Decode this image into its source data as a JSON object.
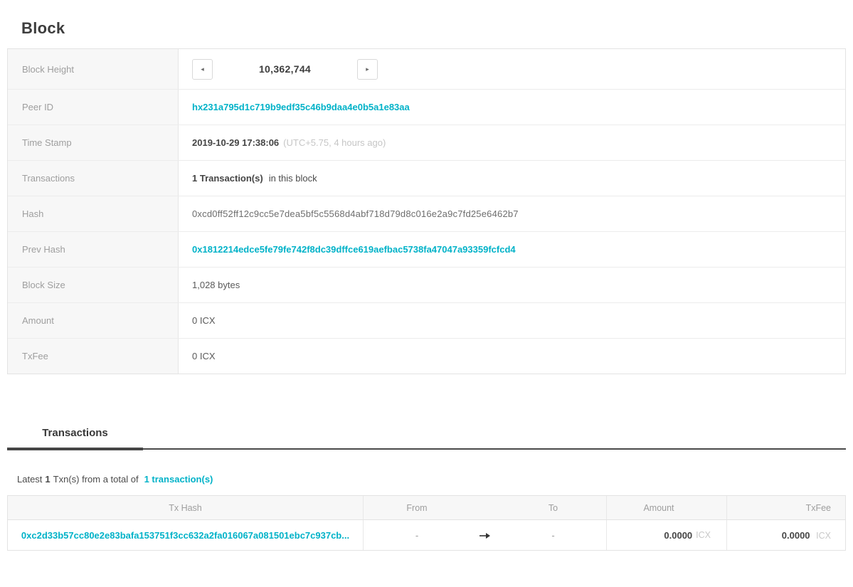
{
  "page": {
    "title": "Block"
  },
  "colors": {
    "accent": "#00b2c8",
    "label_gray": "#9e9e9e",
    "text_dark": "#454545",
    "text_light": "#c6c6c6",
    "border": "#e3e3e3",
    "label_bg": "#f7f7f7",
    "tab_line": "#464646"
  },
  "icons": {
    "prev_block": "◂",
    "next_block": "▸",
    "from_to_arrow": "arrow-right"
  },
  "block_detail": {
    "block_height": {
      "label": "Block Height",
      "value": "10,362,744"
    },
    "peer_id": {
      "label": "Peer ID",
      "value": "hx231a795d1c719b9edf35c46b9daa4e0b5a1e83aa"
    },
    "time_stamp": {
      "label": "Time Stamp",
      "value": "2019-10-29 17:38:06",
      "note": "(UTC+5.75, 4 hours ago)"
    },
    "transactions": {
      "label": "Transactions",
      "count": "1 Transaction(s)",
      "suffix": "in this block"
    },
    "hash": {
      "label": "Hash",
      "value": "0xcd0ff52ff12c9cc5e7dea5bf5c5568d4abf718d79d8c016e2a9c7fd25e6462b7"
    },
    "prev_hash": {
      "label": "Prev Hash",
      "value": "0x1812214edce5fe79fe742f8dc39dffce619aefbac5738fa47047a93359fcfcd4"
    },
    "block_size": {
      "label": "Block Size",
      "value": "1,028 bytes"
    },
    "amount": {
      "label": "Amount",
      "value": "0 ICX"
    },
    "txfee": {
      "label": "TxFee",
      "value": "0 ICX"
    }
  },
  "transactions_section": {
    "tab_label": "Transactions",
    "summary": {
      "prefix": "Latest",
      "count": "1",
      "middle": "Txn(s) from a total of",
      "link": "1 transaction(s)"
    },
    "table": {
      "headers": {
        "tx_hash": "Tx Hash",
        "from": "From",
        "to": "To",
        "amount": "Amount",
        "txfee": "TxFee"
      },
      "rows": [
        {
          "tx_hash": "0xc2d33b57cc80e2e83bafa153751f3cc632a2fa016067a081501ebc7c937cb...",
          "from": "-",
          "to": "-",
          "amount": "0.0000",
          "amount_unit": "ICX",
          "txfee": "0.0000",
          "txfee_unit": "ICX"
        }
      ]
    }
  }
}
